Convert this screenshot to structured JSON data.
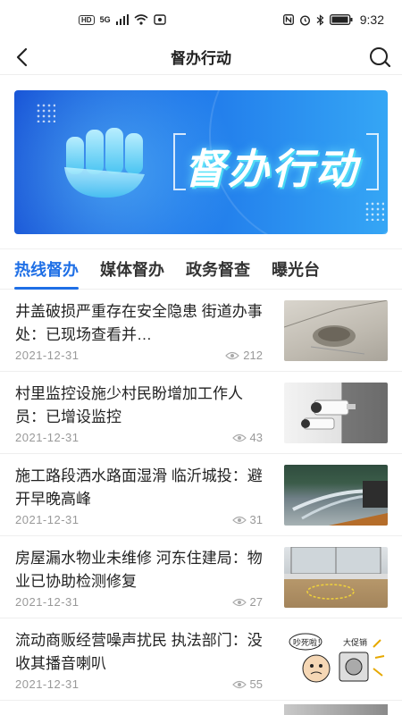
{
  "status_bar": {
    "left_badge": "HD",
    "network": "5G",
    "time": "9:32"
  },
  "header": {
    "title": "督办行动",
    "back_icon": "back-arrow-icon",
    "search_icon": "search-icon"
  },
  "banner": {
    "title": "督办行动",
    "colors": {
      "start": "#1a57d8",
      "end": "#35a6f5"
    }
  },
  "tabs": [
    {
      "label": "热线督办",
      "active": true
    },
    {
      "label": "媒体督办",
      "active": false
    },
    {
      "label": "政务督查",
      "active": false
    },
    {
      "label": "曝光台",
      "active": false
    }
  ],
  "accent_color": "#1e6fe6",
  "articles": [
    {
      "title": "井盖破损严重存在安全隐患 街道办事处：已现场查看并…",
      "date": "2021-12-31",
      "views": "212"
    },
    {
      "title": "村里监控设施少村民盼增加工作人员：已增设监控",
      "date": "2021-12-31",
      "views": "43"
    },
    {
      "title": "施工路段洒水路面湿滑 临沂城投：避开早晚高峰",
      "date": "2021-12-31",
      "views": "31"
    },
    {
      "title": "房屋漏水物业未维修 河东住建局：物业已协助检测修复",
      "date": "2021-12-31",
      "views": "27"
    },
    {
      "title": "流动商贩经营噪声扰民 执法部门：没收其播音喇叭",
      "date": "2021-12-31",
      "views": "55"
    }
  ],
  "thumb5_text": {
    "bubble": "吵死啦！",
    "sign": "大促销"
  }
}
